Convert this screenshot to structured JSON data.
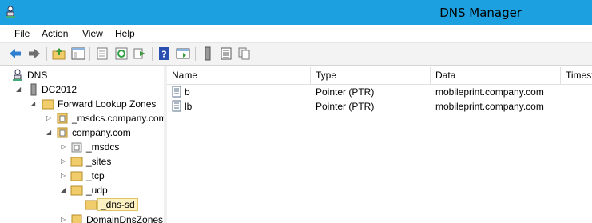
{
  "window": {
    "title": "DNS Manager"
  },
  "menu": {
    "file": "File",
    "action": "Action",
    "view": "View",
    "help": "Help"
  },
  "tree": {
    "root": "DNS",
    "server": "DC2012",
    "forward_zones": "Forward Lookup Zones",
    "msdcs_zone": "_msdcs.company.com",
    "company_zone": "company.com",
    "sub_msdcs": "_msdcs",
    "sub_sites": "_sites",
    "sub_tcp": "_tcp",
    "sub_udp": "_udp",
    "dns_sd": "_dns-sd",
    "domain_dns": "DomainDnsZones"
  },
  "list": {
    "columns": [
      "Name",
      "Type",
      "Data",
      "Timestamp"
    ],
    "rows": [
      {
        "name": "b",
        "type": "Pointer (PTR)",
        "data": "mobileprint.company.com"
      },
      {
        "name": "lb",
        "type": "Pointer (PTR)",
        "data": "mobileprint.company.com"
      }
    ]
  },
  "colors": {
    "titlebar": "#1ca0e0",
    "folder": "#f1cc6a",
    "selected_bg": "#fcf1c2"
  },
  "icons": [
    "back-icon",
    "forward-icon",
    "up-folder-icon",
    "show-hide-tree-icon",
    "properties-icon",
    "refresh-icon",
    "export-icon",
    "help-icon",
    "action-pane-icon",
    "server-icon",
    "list-icon",
    "copy-icon"
  ]
}
